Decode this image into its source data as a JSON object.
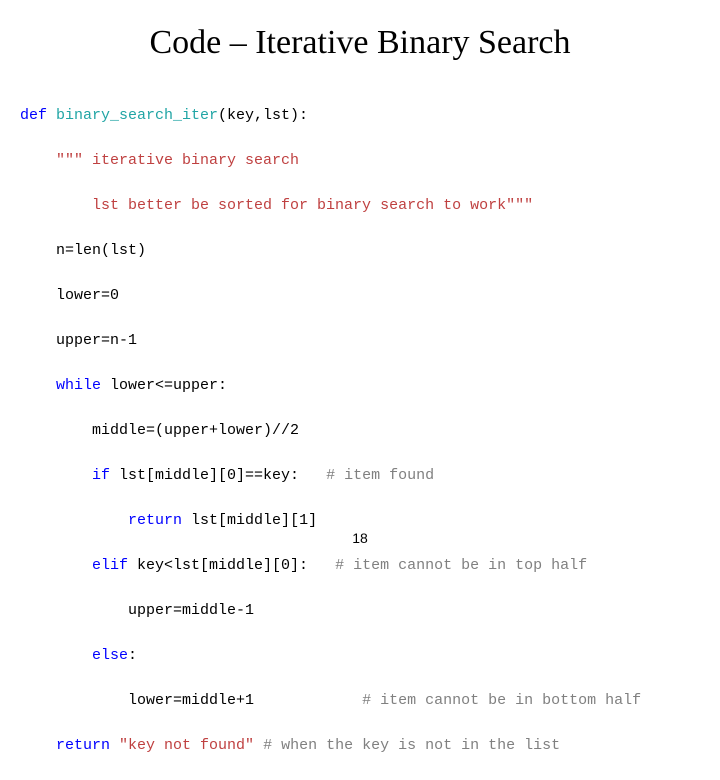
{
  "title": "Code – Iterative Binary Search",
  "page_number": "18",
  "code": {
    "l1": {
      "def": "def ",
      "fn": "binary_search_iter",
      "rest": "(key,lst):"
    },
    "l2": {
      "s": "\"\"\" iterative binary search"
    },
    "l3": {
      "s": "lst better be sorted for binary search to work\"\"\""
    },
    "l4": {
      "a": "n=",
      "b": "len",
      "c": "(lst)"
    },
    "l5": {
      "a": "lower=0"
    },
    "l6": {
      "a": "upper=n-1"
    },
    "l7": {
      "kw": "while ",
      "a": "lower<=upper:"
    },
    "l8": {
      "a": "middle=(upper+lower)//2"
    },
    "l9": {
      "kw": "if ",
      "a": "lst[middle][0]==key:",
      "sp": "   ",
      "c": "# item found"
    },
    "l10": {
      "kw": "return ",
      "a": "lst[middle][1]"
    },
    "l11": {
      "kw": "elif ",
      "a": "key<lst[middle][0]:",
      "sp": "   ",
      "c": "# item cannot be in top half"
    },
    "l12": {
      "a": "upper=middle-1"
    },
    "l13": {
      "kw": "else",
      "a": ":"
    },
    "l14": {
      "a": "lower=middle+1",
      "sp": "            ",
      "c": "# item cannot be in bottom half"
    },
    "l15": {
      "kw": "return ",
      "s": "\"key not found\" ",
      "c": "# when the key is not in the list"
    }
  }
}
